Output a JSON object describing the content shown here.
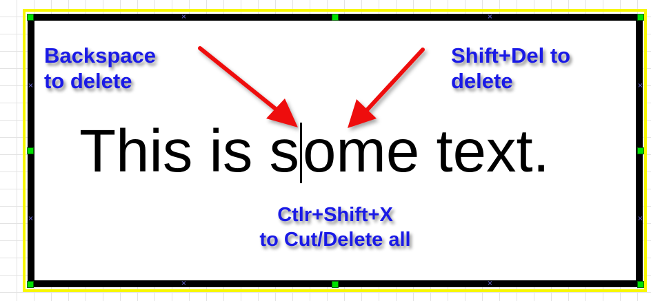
{
  "notes": {
    "backspace": [
      "Backspace",
      "to delete"
    ],
    "shift_del": [
      "Shift+Del to",
      "delete"
    ],
    "ctrl_shift_x": [
      "Ctlr+Shift+X",
      "to Cut/Delete all"
    ]
  },
  "text_box": {
    "before_caret": "This is s",
    "after_caret": "ome text."
  },
  "colors": {
    "annotation_text": "#1a1ae6",
    "arrow": "#ee1111",
    "handle": "#00e000",
    "selection_outline": "#f7f700",
    "box_border": "#000000"
  }
}
